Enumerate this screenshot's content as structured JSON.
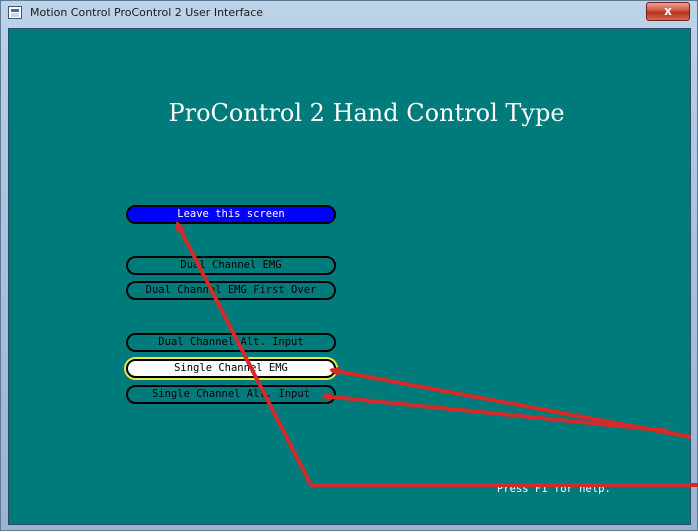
{
  "window": {
    "title": "Motion Control ProControl 2 User Interface",
    "close_label": "x"
  },
  "screen": {
    "title": "ProControl 2 Hand Control Type",
    "help_text": "Press F1 for help."
  },
  "menu": {
    "leave": "Leave this screen",
    "items": [
      "Dual Channel EMG",
      "Dual Channel EMG First Over",
      "Dual Channel Alt. Input",
      "Single Channel EMG",
      "Single Channel Alt. Input"
    ],
    "selected_item": "Single Channel EMG"
  },
  "colors": {
    "background": "#007b7b",
    "active_button": "#0000ff",
    "selected_highlight": "#e9e94a",
    "annotation_arrow": "#d42a2a"
  },
  "icons": {
    "app": "app-window-icon",
    "close": "close-icon"
  }
}
